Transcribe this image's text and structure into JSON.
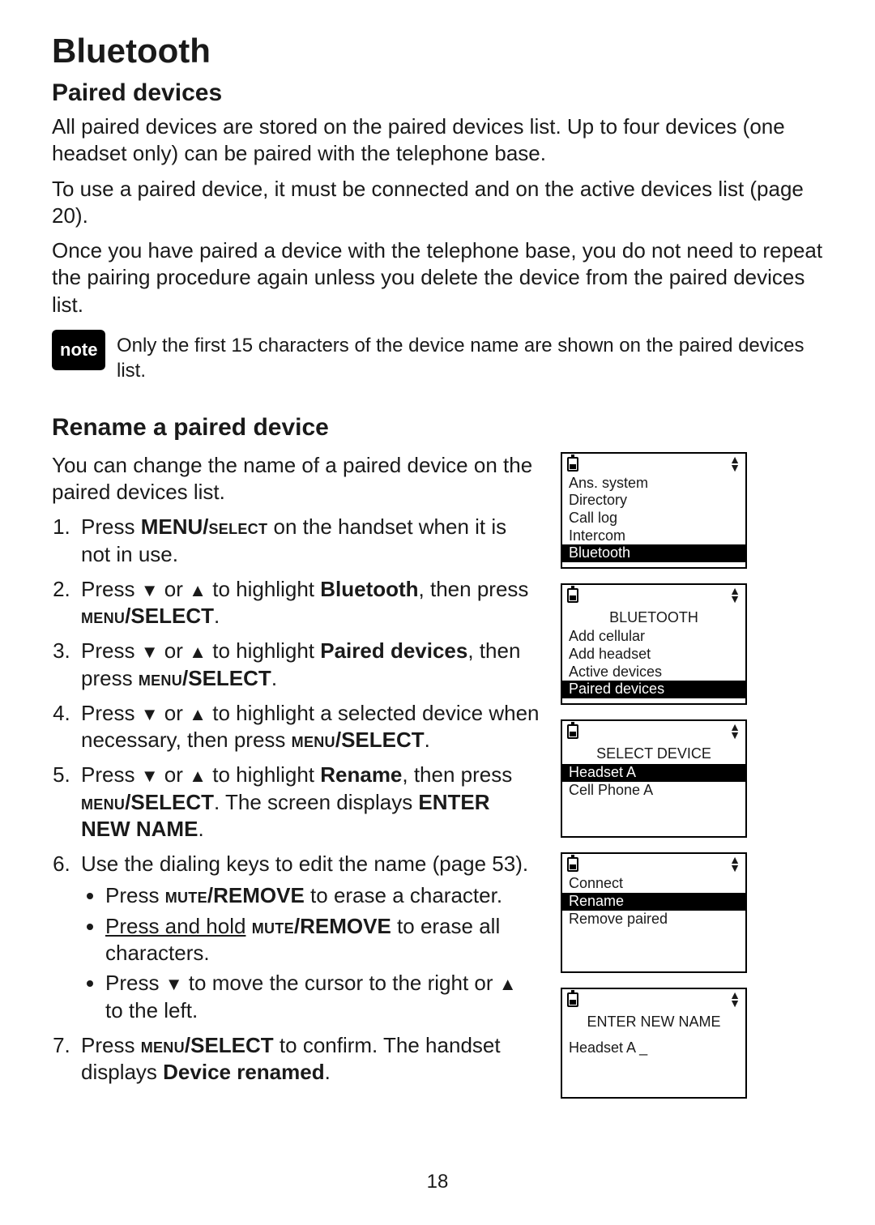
{
  "page_number": "18",
  "title": "Bluetooth",
  "paired": {
    "heading": "Paired devices",
    "p1": "All paired devices are stored on the paired devices list. Up to four devices (one headset only) can be paired with the telephone base.",
    "p2": "To use a paired device, it must be connected and on the active devices list (page 20).",
    "p3": "Once you have paired a device with the telephone base, you do not need to repeat the pairing procedure again unless you delete the device from the paired devices list."
  },
  "note": {
    "badge": "note",
    "text": "Only the first 15 characters of the device name are shown on the paired devices list."
  },
  "rename": {
    "heading": "Rename a paired device",
    "intro": "You can change the name of a paired device on the paired devices list.",
    "s1a": "Press ",
    "s1b_bold": "MENU/",
    "s1b_sc": "select",
    "s1c": " on the handset when it is not in use.",
    "s2a": "Press ",
    "s2b": " or ",
    "s2c": " to highlight ",
    "s2d_bold": "Bluetooth",
    "s2e": ", then press ",
    "ms_sc": "menu",
    "ms_bold": "/SELECT",
    "period": ".",
    "s3d_bold": "Paired devices",
    "s4a": "Press ",
    "s4b": " or ",
    "s4c": " to highlight a selected device when necessary, then press ",
    "s5d_bold": "Rename",
    "s5e": ". The screen displays ",
    "s5f_bold": "ENTER NEW NAME",
    "s6": "Use the dialing keys to edit the name (page 53).",
    "b1a": "Press ",
    "b1_sc": "mute",
    "b1_bold": "/REMOVE",
    "b1b": " to erase a character.",
    "b2a": "Press and hold",
    "b2b": " to erase all characters.",
    "b3a": "Press ",
    "b3b": " to move the cursor to the right or ",
    "b3c": " to the left.",
    "s7a": "Press ",
    "s7b": " to confirm. The handset displays ",
    "s7c_bold": "Device renamed"
  },
  "screens": {
    "menu": {
      "items": [
        "Ans. system",
        "Directory",
        "Call log",
        "Intercom",
        "Bluetooth"
      ],
      "selected": 4
    },
    "bt": {
      "title": "BLUETOOTH",
      "items": [
        "Add cellular",
        "Add headset",
        "Active devices",
        "Paired devices"
      ],
      "selected": 3
    },
    "select": {
      "title": "SELECT DEVICE",
      "items": [
        "Headset A",
        "Cell Phone A"
      ],
      "selected": 0
    },
    "action": {
      "items": [
        "Connect",
        "Rename",
        "Remove paired"
      ],
      "selected": 1
    },
    "enter": {
      "title": "ENTER NEW NAME",
      "value": "Headset A"
    }
  }
}
